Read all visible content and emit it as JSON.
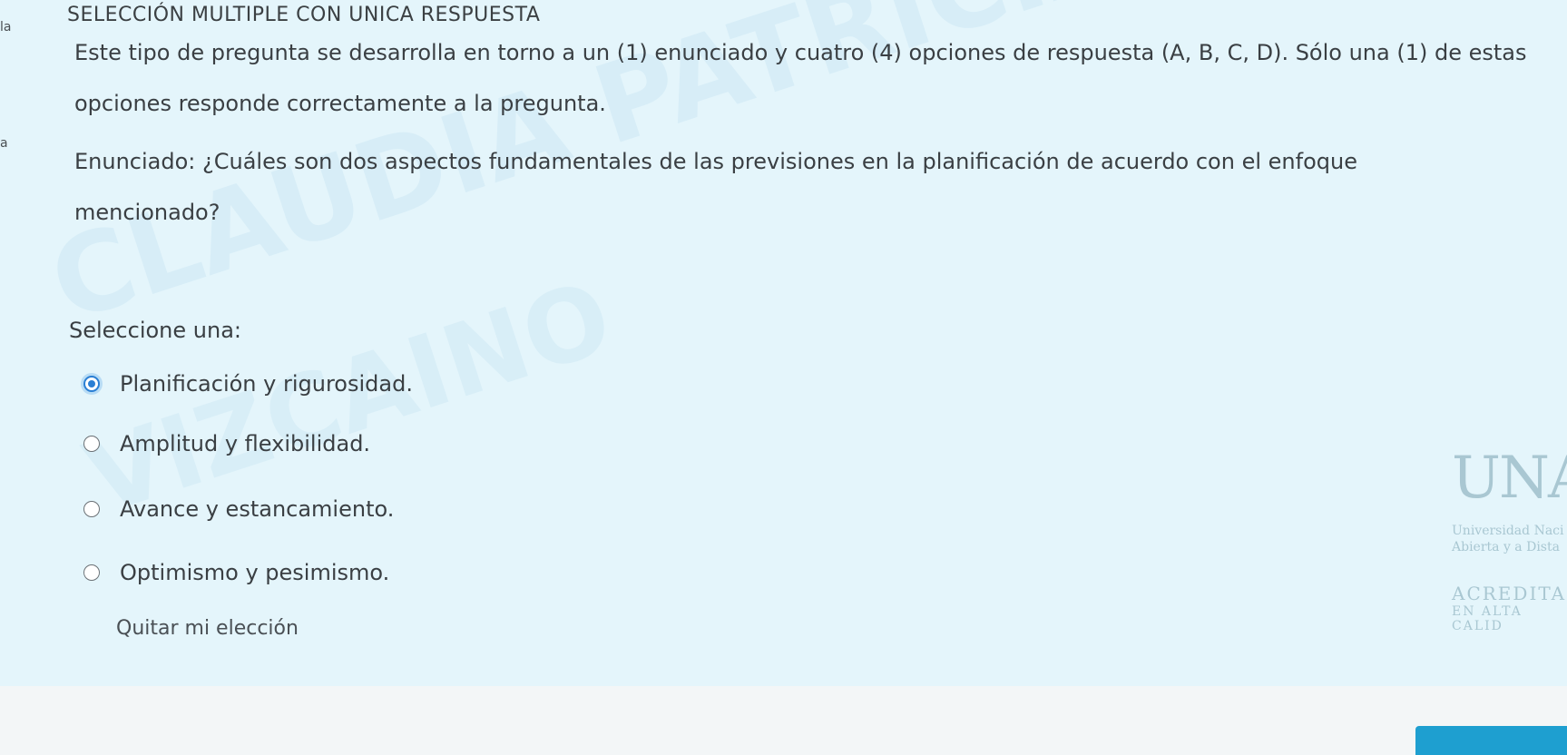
{
  "side_fragments": [
    "la",
    "a"
  ],
  "question": {
    "heading": "SELECCIÓN MULTIPLE CON UNICA RESPUESTA",
    "intro": "Este tipo de pregunta se desarrolla en torno a un (1) enunciado y cuatro (4) opciones de respuesta (A, B, C, D). Sólo una (1) de estas opciones responde correctamente a la pregunta.",
    "statement": "Enunciado: ¿Cuáles son dos aspectos fundamentales de las previsiones en la planificación de acuerdo con el enfoque mencionado?",
    "select_label": "Seleccione una:",
    "options": [
      {
        "label": "Planificación y rigurosidad.",
        "selected": true
      },
      {
        "label": "Amplitud y flexibilidad.",
        "selected": false
      },
      {
        "label": "Avance y estancamiento.",
        "selected": false
      },
      {
        "label": "Optimismo y pesimismo.",
        "selected": false
      }
    ],
    "clear_choice": "Quitar mi elección"
  },
  "watermark": {
    "line1": "CLAUDIA PATRICIA CUBILLOS",
    "line2": "VIZCAINO"
  },
  "logo": {
    "letters": "UNA",
    "line1": "Universidad Naci",
    "line2": "Abierta y a Dista",
    "accred1": "ACREDITAD",
    "accred2": "EN ALTA CALID"
  },
  "colors": {
    "panel_bg": "#e4f5fb",
    "accent": "#2a7fd4",
    "button": "#1e9fd0"
  }
}
